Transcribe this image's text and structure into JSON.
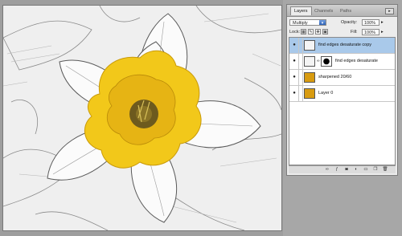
{
  "panel": {
    "tabs": [
      {
        "label": "Layers",
        "active": true
      },
      {
        "label": "Channels",
        "active": false
      },
      {
        "label": "Paths",
        "active": false
      }
    ],
    "blend_mode": "Multiply",
    "opacity_label": "Opacity:",
    "opacity_value": "100%",
    "lock_label": "Lock:",
    "fill_label": "Fill:",
    "fill_value": "100%",
    "layers": [
      {
        "name": "find edges desaturate copy",
        "visible": true,
        "selected": true,
        "thumb": "sketch",
        "has_mask": false
      },
      {
        "name": "find edges desaturate",
        "visible": true,
        "selected": false,
        "thumb": "sketch",
        "has_mask": true
      },
      {
        "name": "sharpened 20/60",
        "visible": true,
        "selected": false,
        "thumb": "gold",
        "has_mask": false
      },
      {
        "name": "Layer 0",
        "visible": true,
        "selected": false,
        "thumb": "gold",
        "has_mask": false
      }
    ],
    "footer_icons": [
      "link-layers-icon",
      "layer-style-icon",
      "add-mask-icon",
      "adjustment-layer-icon",
      "new-group-icon",
      "new-layer-icon",
      "trash-icon"
    ]
  },
  "colors": {
    "accent": "#2f63b7",
    "selection": "#a9c9ea",
    "daffodil": "#f2c81a"
  }
}
